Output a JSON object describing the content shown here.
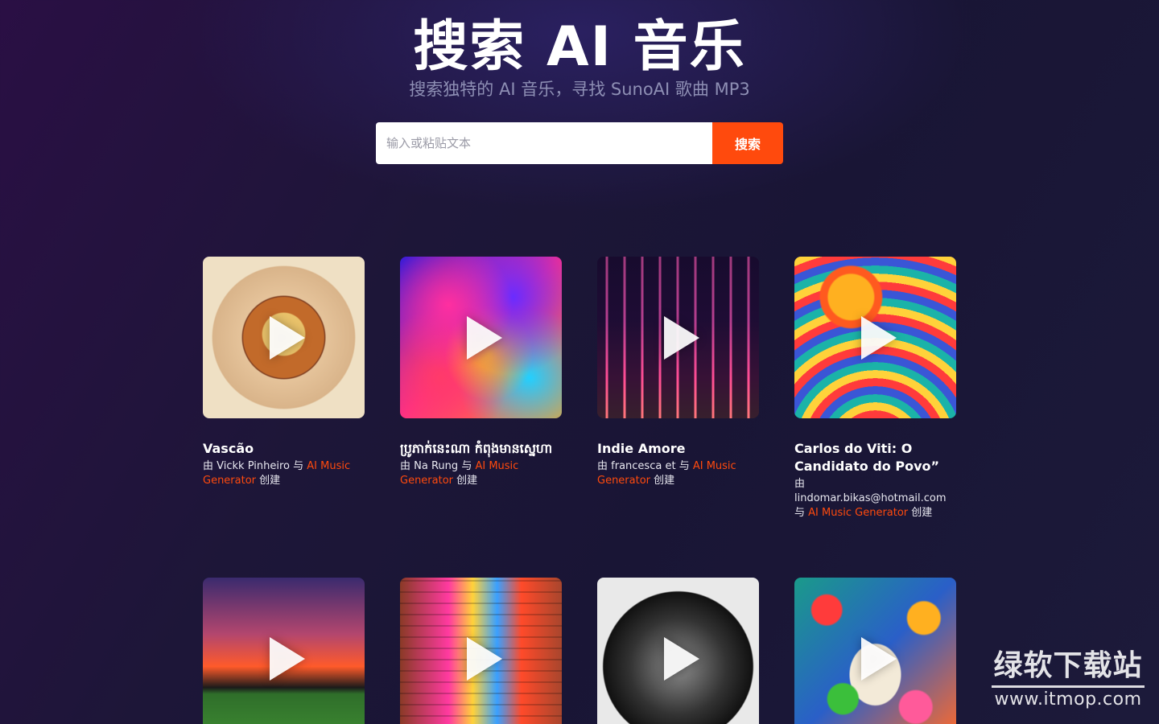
{
  "hero": {
    "title": "搜索 AI 音乐",
    "subtitle": "搜索独特的 AI 音乐，寻找 SunoAI 歌曲 MP3"
  },
  "search": {
    "placeholder": "输入或粘贴文本",
    "value": "",
    "button_label": "搜索"
  },
  "songs": [
    {
      "title": "Vascão",
      "by": "由",
      "author": "Vickk Pinheiro",
      "with": "与",
      "generator": "AI Music Generator",
      "created": "创建"
    },
    {
      "title": "ប្រូភាក់នេះណា កំពុងមានស្នេហា",
      "by": "由",
      "author": "Na Rung",
      "with": "与",
      "generator": "AI Music Generator",
      "created": "创建"
    },
    {
      "title": "Indie Amore",
      "by": "由",
      "author": "francesca et",
      "with": "与",
      "generator": "AI Music Generator",
      "created": "创建"
    },
    {
      "title": "Carlos do Viti: O Candidato do Povo”",
      "by": "由",
      "author": "lindomar.bikas@hotmail.com",
      "with": "与",
      "generator": "AI Music Generator",
      "created": "创建"
    }
  ],
  "watermark": {
    "title": "绿软下载站",
    "url": "www.itmop.com"
  }
}
